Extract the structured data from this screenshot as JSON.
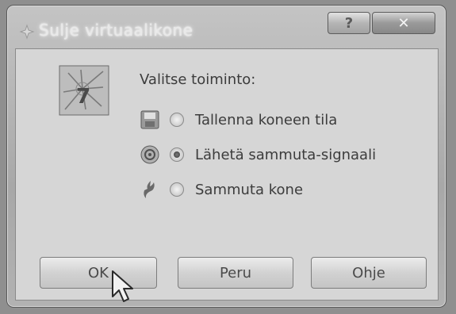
{
  "dialog": {
    "title": "Sulje virtuaalikone",
    "help_button": "?",
    "close_button": "✕",
    "icons": {
      "title": "virtual-machine-icon",
      "app": "virtual-machine-icon"
    }
  },
  "content": {
    "prompt": "Valitse toiminto:",
    "options": [
      {
        "label": "Tallenna koneen tila",
        "icon": "save-state-icon",
        "checked": false
      },
      {
        "label": "Lähetä sammuta-signaali",
        "icon": "power-signal-icon",
        "checked": true
      },
      {
        "label": "Sammuta kone",
        "icon": "power-off-icon",
        "checked": false
      }
    ]
  },
  "buttons": {
    "ok": "OK",
    "cancel": "Peru",
    "help": "Ohje"
  }
}
